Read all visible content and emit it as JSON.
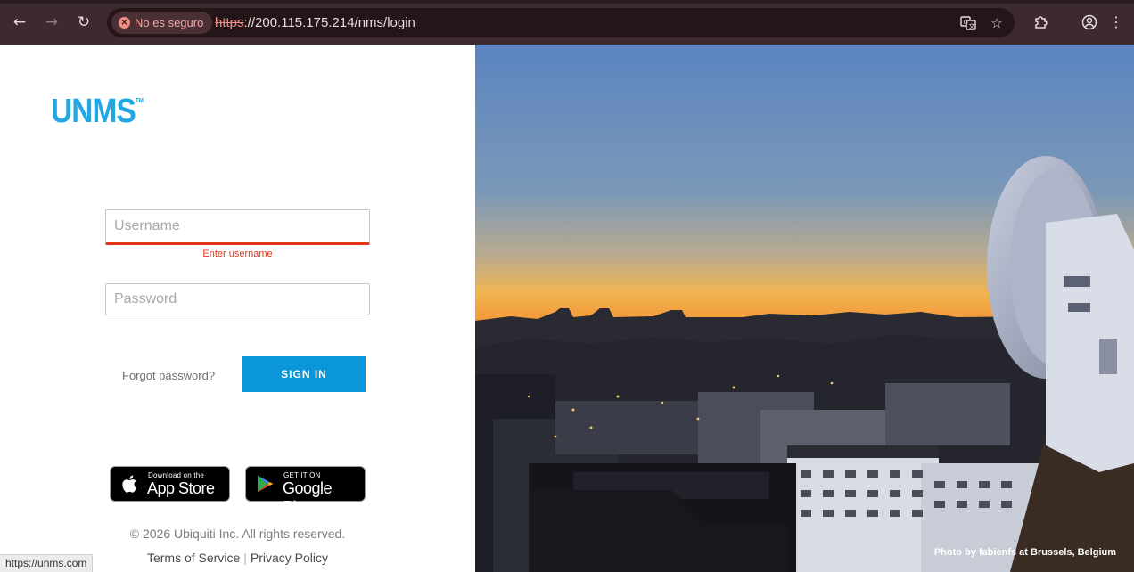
{
  "browser": {
    "security_label": "No es seguro",
    "url_scheme": "https",
    "url_rest": "://200.115.175.214/nms/login",
    "status_url": "https://unms.com"
  },
  "login": {
    "logo_text": "UNMS",
    "logo_tm": "TM",
    "username_placeholder": "Username",
    "username_error": "Enter username",
    "password_placeholder": "Password",
    "forgot_label": "Forgot password?",
    "signin_label": "SIGN IN"
  },
  "badges": {
    "apple_small": "Download on the",
    "apple_big": "App Store",
    "google_small": "GET IT ON",
    "google_big": "Google Play"
  },
  "footer": {
    "copyright": "© 2026 Ubiquiti Inc. All rights reserved.",
    "terms": "Terms of Service",
    "separator": "|",
    "privacy": "Privacy Policy"
  },
  "photo": {
    "credit": "Photo by fabienfs at Brussels, Belgium"
  },
  "colors": {
    "brand": "#21a8e3",
    "signin_button": "#0a96d9",
    "error": "#e2351a",
    "toolbar": "#3c2a2e"
  }
}
